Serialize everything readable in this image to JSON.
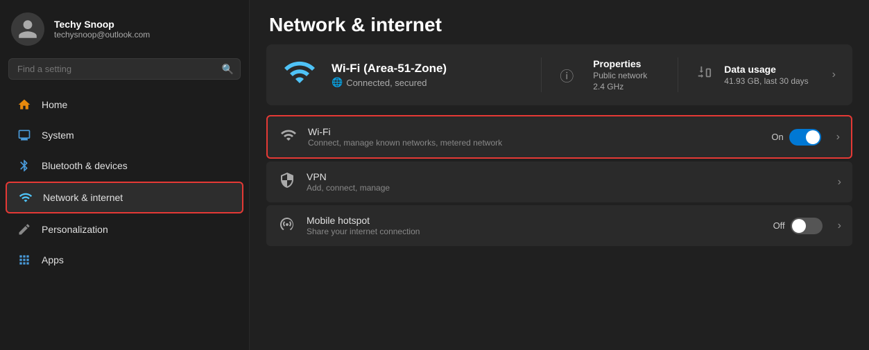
{
  "sidebar": {
    "user": {
      "name": "Techy Snoop",
      "email": "techysnoop@outlook.com"
    },
    "search": {
      "placeholder": "Find a setting"
    },
    "nav_items": [
      {
        "id": "home",
        "label": "Home",
        "icon": "🏠",
        "icon_class": "icon-home",
        "active": false
      },
      {
        "id": "system",
        "label": "System",
        "icon": "🖥",
        "icon_class": "icon-system",
        "active": false
      },
      {
        "id": "bluetooth",
        "label": "Bluetooth & devices",
        "icon": "⦿",
        "icon_class": "icon-bluetooth",
        "active": false
      },
      {
        "id": "network",
        "label": "Network & internet",
        "icon": "📶",
        "icon_class": "icon-network",
        "active": true
      },
      {
        "id": "personalization",
        "label": "Personalization",
        "icon": "✏",
        "icon_class": "icon-personalization",
        "active": false
      },
      {
        "id": "apps",
        "label": "Apps",
        "icon": "⊞",
        "icon_class": "icon-apps",
        "active": false
      }
    ]
  },
  "main": {
    "page_title": "Network & internet",
    "wifi_card": {
      "wifi_name": "Wi-Fi (Area-51-Zone)",
      "connected_text": "Connected, secured",
      "properties_label": "Properties",
      "properties_network": "Public network",
      "properties_freq": "2.4 GHz",
      "data_usage_label": "Data usage",
      "data_usage_value": "41.93 GB, last 30 days"
    },
    "settings_items": [
      {
        "id": "wifi",
        "label": "Wi-Fi",
        "desc": "Connect, manage known networks, metered network",
        "toggle": true,
        "toggle_state": "on",
        "toggle_label": "On",
        "highlighted": true
      },
      {
        "id": "vpn",
        "label": "VPN",
        "desc": "Add, connect, manage",
        "toggle": false,
        "highlighted": false
      },
      {
        "id": "mobile-hotspot",
        "label": "Mobile hotspot",
        "desc": "Share your internet connection",
        "toggle": true,
        "toggle_state": "off",
        "toggle_label": "Off",
        "highlighted": false
      }
    ]
  }
}
